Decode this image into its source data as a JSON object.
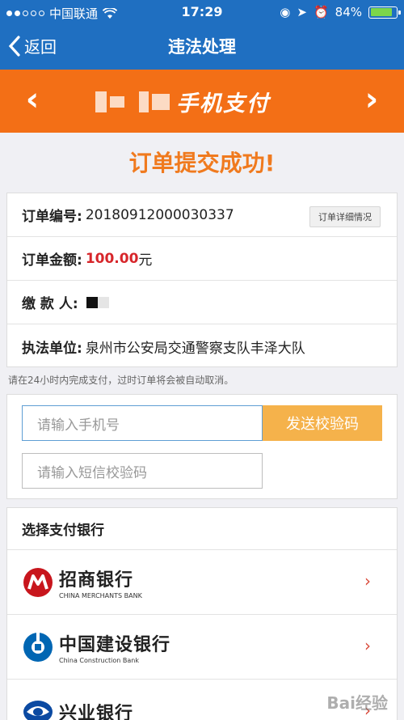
{
  "status": {
    "carrier": "中国联通",
    "time": "17:29",
    "battery": "84%",
    "battery_level": 0.84
  },
  "nav": {
    "back_label": "返回",
    "title": "违法处理"
  },
  "banner": {
    "logo_text": "手机支付"
  },
  "success_title": "订单提交成功!",
  "order": {
    "number_label": "订单编号:",
    "number_value": "20180912000030337",
    "detail_button": "订单详细情况",
    "amount_label": "订单金额:",
    "amount_value": "100.00",
    "amount_unit": "元",
    "payer_label": "缴 款 人:",
    "unit_label": "执法单位:",
    "unit_value": "泉州市公安局交通警察支队丰泽大队"
  },
  "note": "请在24小时内完成支付，过时订单将会被自动取消。",
  "verify": {
    "phone_placeholder": "请输入手机号",
    "send_button": "发送校验码",
    "code_placeholder": "请输入短信校验码"
  },
  "banks": {
    "title": "选择支付银行",
    "items": [
      {
        "cn": "招商银行",
        "en": "CHINA MERCHANTS BANK",
        "icon": "cmb-logo-icon",
        "color": "#c8161d"
      },
      {
        "cn": "中国建设银行",
        "en": "China Construction Bank",
        "icon": "ccb-logo-icon",
        "color": "#0066b3"
      },
      {
        "cn": "兴业银行",
        "en": "",
        "icon": "cib-logo-icon",
        "color": "#0b4aa2"
      }
    ]
  },
  "watermark": "Bai经验"
}
